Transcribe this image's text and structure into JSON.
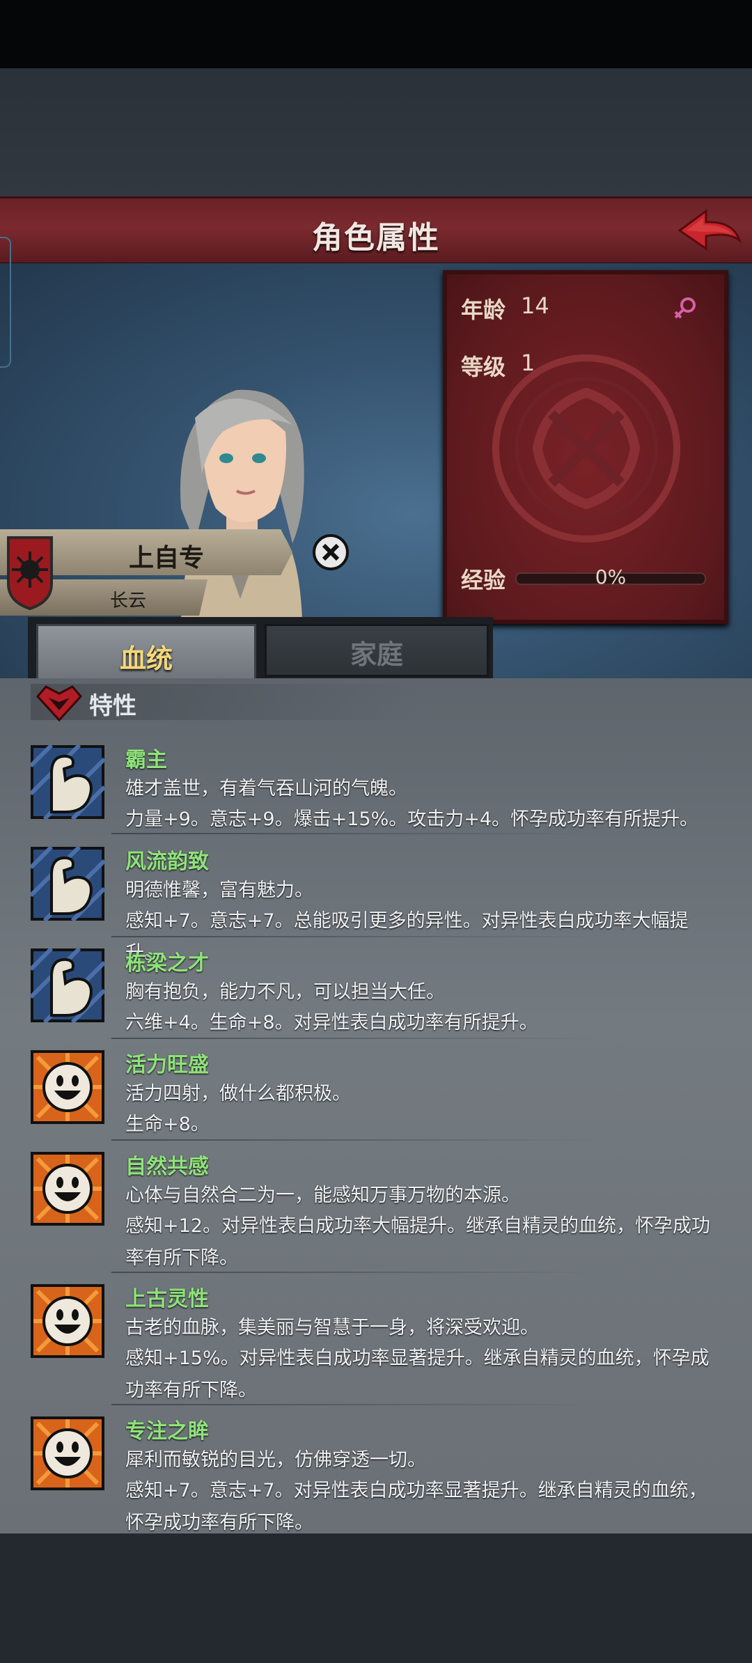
{
  "header": {
    "title": "角色属性"
  },
  "character": {
    "name": "上自专",
    "subtitle": "长云"
  },
  "stats": {
    "age_label": "年龄",
    "age_value": "14",
    "level_label": "等级",
    "level_value": "1",
    "exp_label": "经验",
    "exp_value": "0%",
    "exp_progress": 0
  },
  "tabs": [
    {
      "label": "血统",
      "active": true
    },
    {
      "label": "家庭",
      "active": false
    }
  ],
  "section": {
    "title": "特性"
  },
  "traits": [
    {
      "icon": "arm-icon",
      "name": "霸主",
      "desc": "雄才盖世，有着气吞山河的气魄。",
      "effect": "力量+9。意志+9。爆击+15%。攻击力+4。怀孕成功率有所提升。"
    },
    {
      "icon": "arm-icon",
      "name": "风流韵致",
      "desc": "明德惟馨，富有魅力。",
      "effect": "感知+7。意志+7。总能吸引更多的异性。对异性表白成功率大幅提升。"
    },
    {
      "icon": "arm-icon",
      "name": "栋梁之才",
      "desc": "胸有抱负，能力不凡，可以担当大任。",
      "effect": "六维+4。生命+8。对异性表白成功率有所提升。"
    },
    {
      "icon": "smiley-icon",
      "name": "活力旺盛",
      "desc": "活力四射，做什么都积极。",
      "effect": "生命+8。"
    },
    {
      "icon": "smiley-icon",
      "name": "自然共感",
      "desc": "心体与自然合二为一，能感知万事万物的本源。",
      "effect": "感知+12。对异性表白成功率大幅提升。继承自精灵的血统，怀孕成功率有所下降。"
    },
    {
      "icon": "smiley-icon",
      "name": "上古灵性",
      "desc": "古老的血脉，集美丽与智慧于一身，将深受欢迎。",
      "effect": "感知+15%。对异性表白成功率显著提升。继承自精灵的血统，怀孕成功率有所下降。"
    },
    {
      "icon": "smiley-icon",
      "name": "专注之眸",
      "desc": "犀利而敏锐的目光，仿佛穿透一切。",
      "effect": "感知+7。意志+7。对异性表白成功率显著提升。继承自精灵的血统，怀孕成功率有所下降。"
    }
  ]
}
